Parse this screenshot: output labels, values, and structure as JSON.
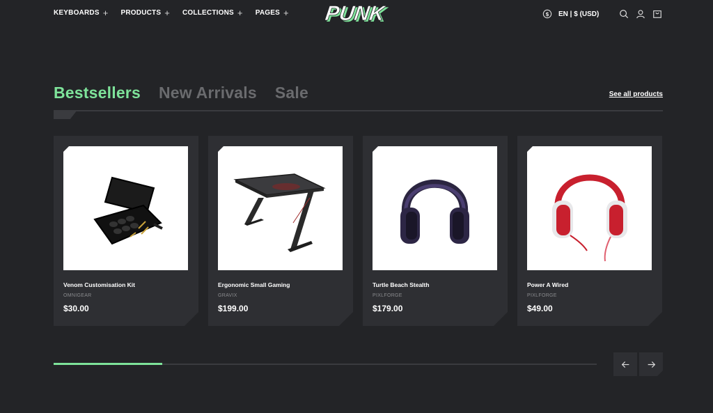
{
  "nav": {
    "items": [
      {
        "label": "KEYBOARDS"
      },
      {
        "label": "PRODUCTS"
      },
      {
        "label": "COLLECTIONS"
      },
      {
        "label": "PAGES"
      }
    ],
    "plus_glyph": "+"
  },
  "brand": {
    "logo_text": "PUNK"
  },
  "header_tools": {
    "currency_label": "EN | $ (USD)",
    "icons": [
      "dollar-icon",
      "search-icon",
      "user-icon",
      "cart-icon"
    ]
  },
  "tabs": [
    {
      "label": "Bestsellers",
      "active": true
    },
    {
      "label": "New Arrivals",
      "active": false
    },
    {
      "label": "Sale",
      "active": false
    }
  ],
  "see_all_label": "See all products",
  "products": [
    {
      "name": "Venom Customisation Kit",
      "brand": "OMNIGEAR",
      "price": "$30.00"
    },
    {
      "name": "Ergonomic Small Gaming",
      "brand": "GRAVIX",
      "price": "$199.00"
    },
    {
      "name": "Turtle Beach Stealth",
      "brand": "PIXLFORGE",
      "price": "$179.00"
    },
    {
      "name": "Power A Wired",
      "brand": "PIXLFORGE",
      "price": "$49.00"
    }
  ],
  "slider": {
    "progress": 0.2
  },
  "colors": {
    "accent": "#7ee39a",
    "background": "#232427",
    "card": "#2e2f33",
    "muted_tab": "#6a6b6e"
  }
}
